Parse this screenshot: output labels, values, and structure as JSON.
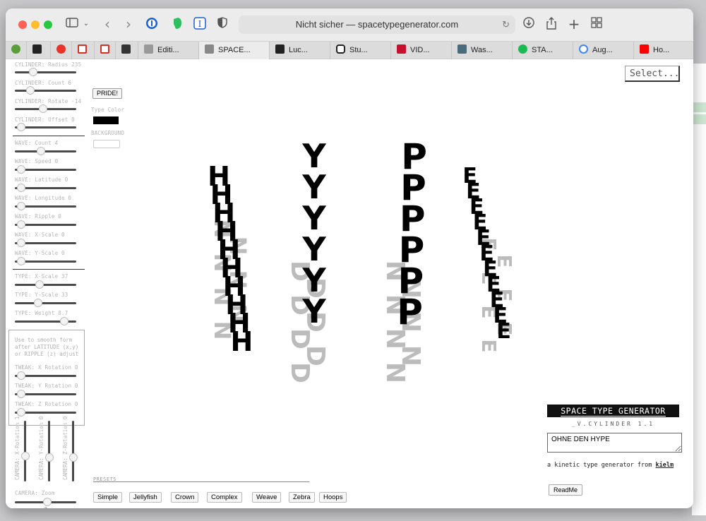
{
  "browser": {
    "url": "Nicht sicher — spacetypegenerator.com",
    "tabs": [
      "",
      "",
      "",
      "",
      "",
      "",
      "Editi...",
      "SPACE...",
      "Luc...",
      "Stu...",
      "VID...",
      "Was...",
      "STA...",
      "Aug...",
      "Ho..."
    ]
  },
  "controls": {
    "cylinder": [
      "CYLINDER: Radius 235",
      "CYLINDER: Count 6",
      "CYLINDER: Rotate -14",
      "CYLINDER: Offset 0"
    ],
    "wave": [
      "WAVE: Count 4",
      "WAVE: Speed 0",
      "WAVE: Latitude  0",
      "WAVE: Longitude 0",
      "WAVE: Ripple 0",
      "WAVE: X-Scale 0",
      "WAVE: Y-Scale 0"
    ],
    "type": [
      "TYPE: X-Scale 37",
      "TYPE: Y-Scale 33",
      "TYPE: Weight 8.7"
    ],
    "hint": "Use to smooth form after LATITUDE (x,y) or RIPPLE (z) adjust",
    "tweak": [
      "TWEAK: X Rotation 0",
      "TWEAK: Y Rotation 0",
      "TWEAK: Z Rotation 0"
    ],
    "camera": [
      "CAMERA: X-Rotation 1",
      "CAMERA: Y-Rotation 0",
      "CAMERA: Z-Rotation 0"
    ],
    "zoom_label": "CAMERA: Zoom",
    "zoom_value": "3"
  },
  "color": {
    "pride_label": "PRIDE!",
    "type_color_label": "Type Color",
    "background_label": "BACKGROUND",
    "type_color": "#000000",
    "background_color": "#ffffff"
  },
  "select_label": "Select...",
  "app": {
    "title": "SPACE TYPE GENERATOR",
    "subtitle": "_V.CYLINDER 1.1",
    "text_value": "OHNE DEN HYPE",
    "tagline": "a kinetic type generator from",
    "author": "kielm",
    "readme_label": "ReadMe"
  },
  "presets": {
    "label": "PRESETS",
    "items": [
      "Simple",
      "Jellyfish",
      "Crown",
      "Complex",
      "Weave",
      "Zebra",
      "Hoops"
    ]
  },
  "letters": {
    "front": [
      "H",
      "Y",
      "P",
      "E"
    ],
    "back": [
      "N",
      "D",
      "N",
      "E"
    ]
  }
}
